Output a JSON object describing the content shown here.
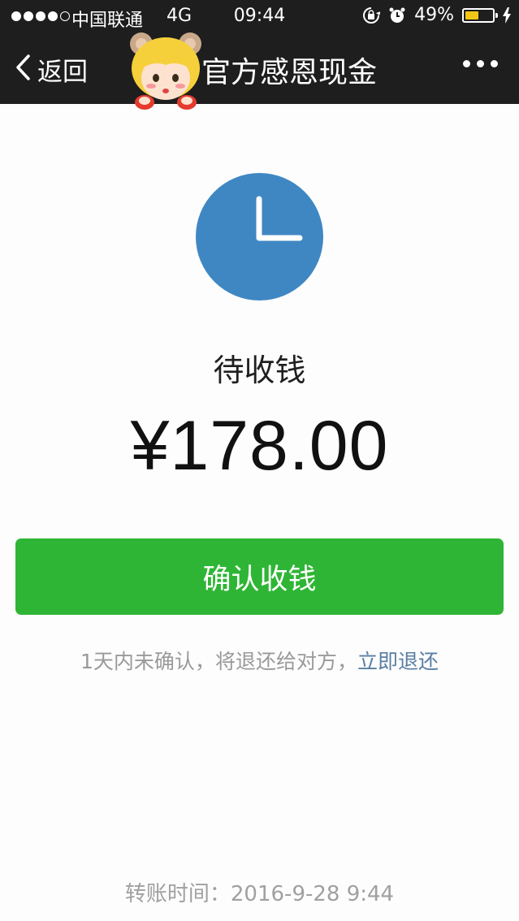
{
  "status_bar": {
    "carrier": "中国联通",
    "network": "4G",
    "time": "09:44",
    "battery_percent_label": "49%",
    "battery_level": 0.49,
    "icons": [
      "signal-dots-icon",
      "rotation-lock-icon",
      "alarm-icon",
      "battery-icon",
      "charging-icon"
    ]
  },
  "nav": {
    "back_label": "返回",
    "title": "官方感恩现金",
    "more_icon": "more-dots-icon",
    "sticker_icon": "cartoon-girl-sticker"
  },
  "main": {
    "status_icon": "clock-icon",
    "status_text": "待收钱",
    "amount": "¥178.00",
    "confirm_label": "确认收钱",
    "notice_text": "1天内未确认，将退还给对方，",
    "refund_link": "立即退还",
    "transfer_time": "转账时间：2016-9-28 9:44"
  },
  "colors": {
    "bar_background": "#1e1e1e",
    "clock_blue": "#3f87c3",
    "confirm_green": "#2fb535",
    "link_blue": "#5b7ea3",
    "battery_yellow": "#f5c518"
  }
}
